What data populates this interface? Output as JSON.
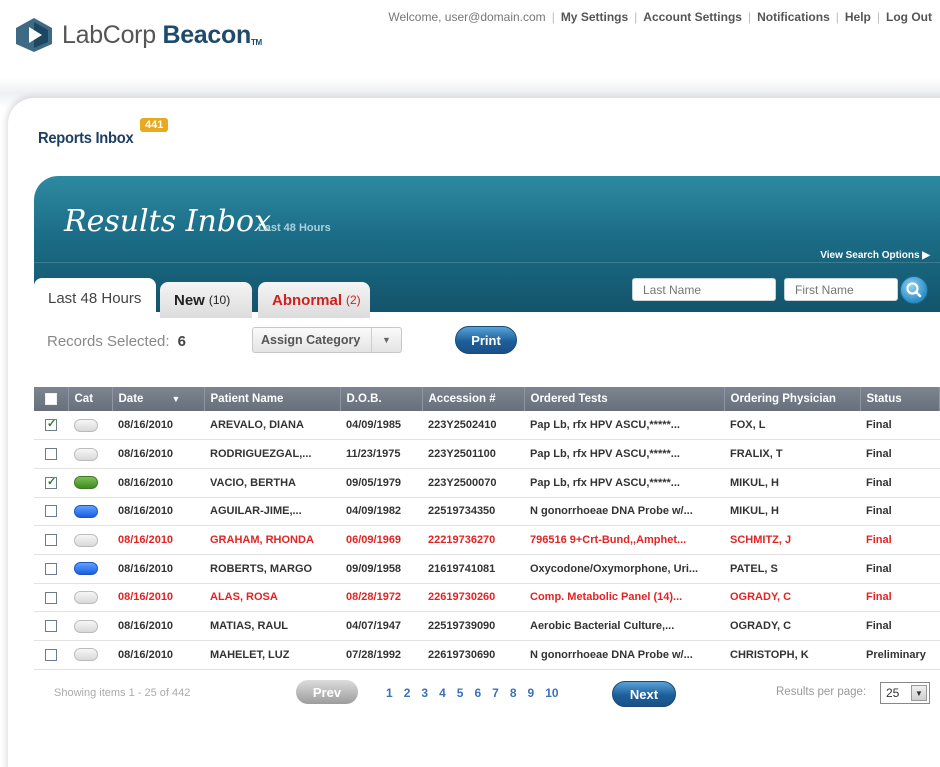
{
  "header": {
    "logo_text_light": "LabCorp ",
    "logo_text_bold": "Beacon",
    "logo_tm": "TM",
    "welcome": "Welcome, user@domain.com",
    "nav": [
      "My Settings",
      "Account Settings",
      "Notifications",
      "Help",
      "Log Out"
    ]
  },
  "reports_inbox": {
    "label": "Reports Inbox",
    "badge": "441"
  },
  "banner": {
    "title": "Results Inbox",
    "subtitle": "Last 48 Hours",
    "view_search_options": "View Search Options ▶"
  },
  "tabs": [
    {
      "label": "Last 48 Hours",
      "count": ""
    },
    {
      "label": "New",
      "count": "(10)"
    },
    {
      "label": "Abnormal",
      "count": "(2)"
    }
  ],
  "search": {
    "last_name_placeholder": "Last Name",
    "first_name_placeholder": "First Name"
  },
  "toolbar": {
    "records_selected_label": "Records Selected:",
    "records_selected_count": "6",
    "assign_category": "Assign Category",
    "print": "Print"
  },
  "table": {
    "headers": [
      "Cat",
      "Date",
      "Patient Name",
      "D.O.B.",
      "Accession #",
      "Ordered Tests",
      "Ordering Physician",
      "Status"
    ],
    "rows": [
      {
        "checked": true,
        "cat": "gray",
        "date": "08/16/2010",
        "patient": "AREVALO, DIANA",
        "dob": "04/09/1985",
        "accession": "223Y2502410",
        "tests": "Pap Lb, rfx HPV ASCU,*****...",
        "physician": "FOX, L",
        "status": "Final",
        "alert": false
      },
      {
        "checked": false,
        "cat": "gray",
        "date": "08/16/2010",
        "patient": "RODRIGUEZGAL,...",
        "dob": "11/23/1975",
        "accession": "223Y2501100",
        "tests": "Pap Lb, rfx HPV ASCU,*****...",
        "physician": "FRALIX, T",
        "status": "Final",
        "alert": false
      },
      {
        "checked": true,
        "cat": "green",
        "date": "08/16/2010",
        "patient": "VACIO, BERTHA",
        "dob": "09/05/1979",
        "accession": "223Y2500070",
        "tests": "Pap Lb, rfx HPV ASCU,*****...",
        "physician": "MIKUL, H",
        "status": "Final",
        "alert": false
      },
      {
        "checked": false,
        "cat": "blue",
        "date": "08/16/2010",
        "patient": "AGUILAR-JIME,...",
        "dob": "04/09/1982",
        "accession": "22519734350",
        "tests": "N gonorrhoeae DNA Probe w/...",
        "physician": "MIKUL, H",
        "status": "Final",
        "alert": false
      },
      {
        "checked": false,
        "cat": "gray",
        "date": "08/16/2010",
        "patient": "GRAHAM, RHONDA",
        "dob": "06/09/1969",
        "accession": "22219736270",
        "tests": "796516 9+Crt-Bund,,Amphet...",
        "physician": "SCHMITZ, J",
        "status": "Final",
        "alert": true
      },
      {
        "checked": false,
        "cat": "blue",
        "date": "08/16/2010",
        "patient": "ROBERTS, MARGO",
        "dob": "09/09/1958",
        "accession": "21619741081",
        "tests": "Oxycodone/Oxymorphone, Uri...",
        "physician": "PATEL, S",
        "status": "Final",
        "alert": false
      },
      {
        "checked": false,
        "cat": "gray",
        "date": "08/16/2010",
        "patient": "ALAS, ROSA",
        "dob": "08/28/1972",
        "accession": "22619730260",
        "tests": "Comp. Metabolic Panel (14)...",
        "physician": "OGRADY, C",
        "status": "Final",
        "alert": true
      },
      {
        "checked": false,
        "cat": "gray",
        "date": "08/16/2010",
        "patient": "MATIAS, RAUL",
        "dob": "04/07/1947",
        "accession": "22519739090",
        "tests": "Aerobic Bacterial Culture,...",
        "physician": "OGRADY, C",
        "status": "Final",
        "alert": false
      },
      {
        "checked": false,
        "cat": "gray",
        "date": "08/16/2010",
        "patient": "MAHELET, LUZ",
        "dob": "07/28/1992",
        "accession": "22619730690",
        "tests": "N gonorrhoeae DNA Probe w/...",
        "physician": "CHRISTOPH, K",
        "status": "Preliminary",
        "alert": false
      }
    ]
  },
  "footer": {
    "showing": "Showing items 1 - 25 of 442",
    "prev": "Prev",
    "pages": [
      "1",
      "2",
      "3",
      "4",
      "5",
      "6",
      "7",
      "8",
      "9",
      "10"
    ],
    "next": "Next",
    "results_per_page_label": "Results per page:",
    "results_per_page_value": "25"
  },
  "colors": {
    "teal": "#1b6c86",
    "alert_red": "#e32323",
    "badge_orange": "#e7a91d",
    "link_blue": "#3a72b8"
  }
}
